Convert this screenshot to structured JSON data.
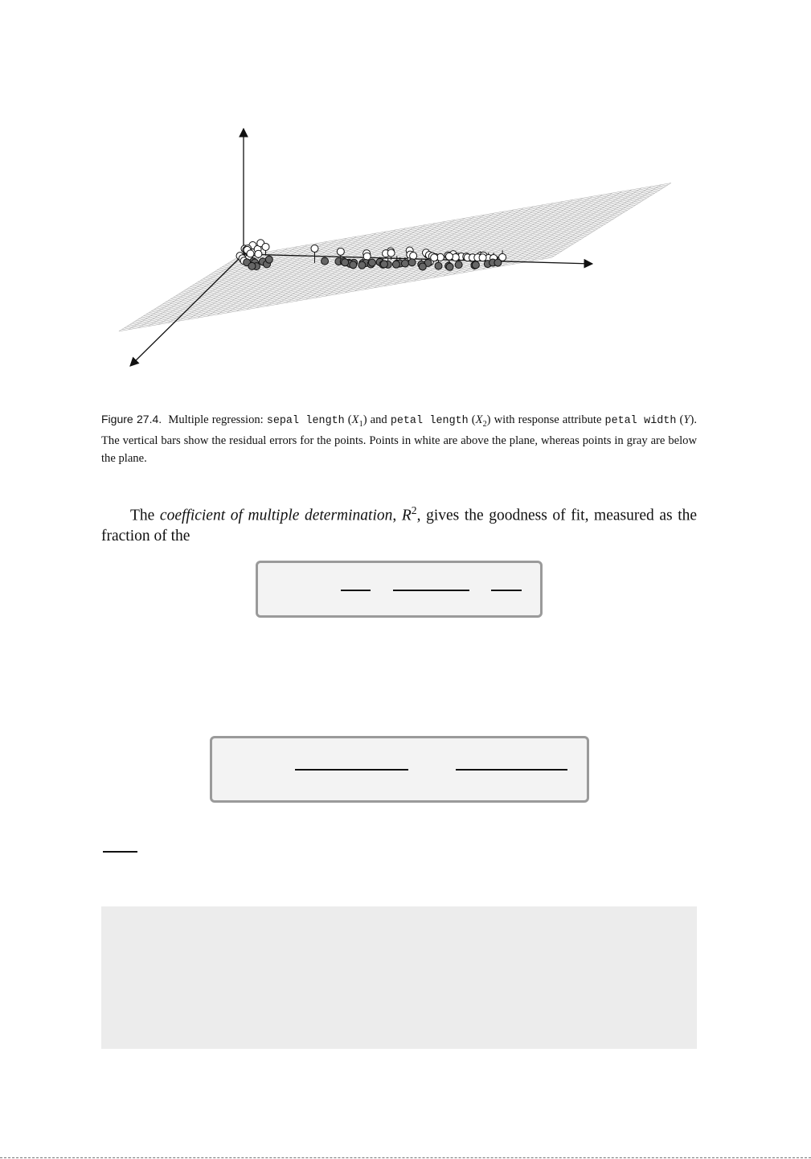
{
  "figure": {
    "label": "Figure 27.4.",
    "caption_parts": {
      "t1": "Multiple regression: ",
      "var1": "sepal length",
      "t2": " (",
      "x1": "X",
      "x1_sub": "1",
      "t3": ") and ",
      "var2": "petal length",
      "t4": " (",
      "x2": "X",
      "x2_sub": "2",
      "t5": ") with response attribute ",
      "var3": "petal width",
      "t6": " (",
      "y": "Y",
      "t7": "). The vertical bars show the residual errors for the points. Points in white are above the plane, whereas points in gray are below the plane."
    }
  },
  "paragraph": {
    "t1": "The ",
    "term": "coefficient of multiple determination",
    "t2": ", ",
    "r": "R",
    "r_sup": "2",
    "t3": ", gives the goodness of fit, measured as the fraction of the"
  },
  "chart_data": {
    "type": "scatter",
    "title": "",
    "xlabel": "",
    "ylabel": "",
    "zlabel": "",
    "grid": false,
    "series": [
      {
        "fill": "#ffffff",
        "points": [
          [
            0.02,
            0.06,
            0.1
          ],
          [
            0.03,
            0.08,
            0.11
          ],
          [
            0.02,
            0.11,
            0.09
          ],
          [
            0.04,
            0.05,
            0.12
          ],
          [
            0.05,
            0.09,
            0.1
          ],
          [
            0.03,
            0.12,
            0.08
          ],
          [
            0.06,
            0.07,
            0.11
          ],
          [
            0.05,
            0.13,
            0.09
          ],
          [
            0.04,
            0.1,
            0.14
          ],
          [
            0.06,
            0.04,
            0.13
          ],
          [
            0.07,
            0.1,
            0.1
          ],
          [
            0.03,
            0.07,
            0.1
          ],
          [
            0.05,
            0.11,
            0.11
          ],
          [
            0.08,
            0.06,
            0.12
          ],
          [
            0.04,
            0.14,
            0.08
          ],
          [
            0.32,
            0.42,
            0.46
          ],
          [
            0.4,
            0.44,
            0.46
          ],
          [
            0.48,
            0.46,
            0.47
          ],
          [
            0.56,
            0.5,
            0.53
          ],
          [
            0.62,
            0.52,
            0.56
          ],
          [
            0.68,
            0.55,
            0.56
          ],
          [
            0.56,
            0.55,
            0.56
          ],
          [
            0.64,
            0.58,
            0.56
          ],
          [
            0.52,
            0.6,
            0.58
          ],
          [
            0.7,
            0.6,
            0.55
          ],
          [
            0.6,
            0.64,
            0.65
          ],
          [
            0.66,
            0.66,
            0.66
          ],
          [
            0.7,
            0.64,
            0.66
          ],
          [
            0.68,
            0.7,
            0.69
          ],
          [
            0.72,
            0.68,
            0.68
          ],
          [
            0.74,
            0.72,
            0.71
          ],
          [
            0.78,
            0.7,
            0.7
          ],
          [
            0.8,
            0.72,
            0.73
          ],
          [
            0.76,
            0.76,
            0.74
          ],
          [
            0.82,
            0.75,
            0.74
          ],
          [
            0.78,
            0.78,
            0.76
          ],
          [
            0.84,
            0.78,
            0.77
          ],
          [
            0.86,
            0.8,
            0.79
          ],
          [
            0.88,
            0.82,
            0.8
          ],
          [
            0.84,
            0.84,
            0.82
          ],
          [
            0.9,
            0.8,
            0.8
          ],
          [
            0.88,
            0.86,
            0.84
          ],
          [
            0.92,
            0.84,
            0.84
          ],
          [
            0.94,
            0.86,
            0.84
          ],
          [
            0.9,
            0.88,
            0.86
          ],
          [
            0.96,
            0.88,
            0.86
          ],
          [
            0.98,
            0.86,
            0.85
          ],
          [
            0.92,
            0.9,
            0.88
          ],
          [
            0.94,
            0.92,
            0.9
          ],
          [
            0.74,
            0.7,
            0.68
          ],
          [
            0.8,
            0.76,
            0.75
          ]
        ]
      },
      {
        "fill": "#666666",
        "points": [
          [
            0.05,
            0.08,
            0.02
          ],
          [
            0.06,
            0.1,
            0.03
          ],
          [
            0.07,
            0.12,
            0.02
          ],
          [
            0.04,
            0.11,
            0.04
          ],
          [
            0.08,
            0.09,
            0.03
          ],
          [
            0.06,
            0.13,
            0.03
          ],
          [
            0.1,
            0.12,
            0.04
          ],
          [
            0.09,
            0.06,
            0.02
          ],
          [
            0.36,
            0.46,
            0.4
          ],
          [
            0.4,
            0.46,
            0.4
          ],
          [
            0.42,
            0.48,
            0.42
          ],
          [
            0.44,
            0.5,
            0.43
          ],
          [
            0.46,
            0.52,
            0.45
          ],
          [
            0.48,
            0.5,
            0.43
          ],
          [
            0.5,
            0.54,
            0.47
          ],
          [
            0.52,
            0.56,
            0.48
          ],
          [
            0.54,
            0.54,
            0.48
          ],
          [
            0.56,
            0.58,
            0.5
          ],
          [
            0.58,
            0.6,
            0.52
          ],
          [
            0.6,
            0.58,
            0.51
          ],
          [
            0.62,
            0.62,
            0.55
          ],
          [
            0.64,
            0.64,
            0.57
          ],
          [
            0.46,
            0.56,
            0.48
          ],
          [
            0.5,
            0.58,
            0.49
          ],
          [
            0.54,
            0.62,
            0.55
          ],
          [
            0.58,
            0.64,
            0.56
          ],
          [
            0.62,
            0.66,
            0.58
          ],
          [
            0.66,
            0.64,
            0.58
          ],
          [
            0.7,
            0.62,
            0.56
          ],
          [
            0.44,
            0.54,
            0.47
          ],
          [
            0.48,
            0.6,
            0.51
          ],
          [
            0.72,
            0.76,
            0.68
          ],
          [
            0.78,
            0.8,
            0.71
          ],
          [
            0.82,
            0.84,
            0.75
          ],
          [
            0.86,
            0.88,
            0.8
          ],
          [
            0.9,
            0.86,
            0.78
          ],
          [
            0.92,
            0.92,
            0.84
          ],
          [
            0.96,
            0.94,
            0.87
          ],
          [
            0.98,
            0.96,
            0.9
          ],
          [
            1.0,
            0.98,
            0.92
          ],
          [
            0.74,
            0.82,
            0.72
          ],
          [
            0.84,
            0.9,
            0.8
          ]
        ]
      }
    ]
  }
}
